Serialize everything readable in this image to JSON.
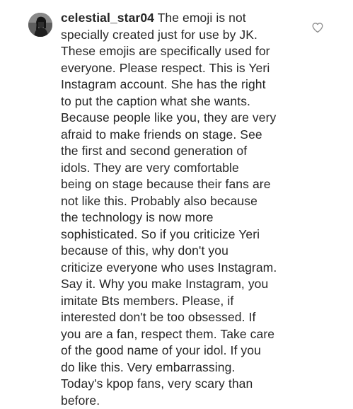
{
  "comment": {
    "username": "celestial_star04",
    "lines": [
      " The emoji is not",
      "specially created just for use by JK.",
      "These emojis are specifically used for",
      "everyone.  Please respect.  This is Yeri",
      "Instagram account.  She has the right",
      "to put the caption what she wants.",
      "Because people like you, they are very",
      "afraid to make friends on stage.  See",
      "the first and second generation of",
      "idols.  They are very comfortable",
      "being on stage because their fans are",
      "not like this.  Probably also because",
      "the technology is now more",
      "sophisticated.  So if you criticize Yeri",
      "because of this, why don't you",
      "criticize everyone who uses Instagram.",
      "Say it.  Why you make Instagram, you",
      "imitate Bts members.  Please, if",
      "interested don't be too obsessed.  If",
      "you are a fan, respect them.  Take care",
      "of the good name of your idol.  If you",
      "do like this.  Very embarrassing.",
      "Today's kpop fans, very scary than",
      "before."
    ]
  },
  "icons": {
    "avatar": "avatar",
    "like": "heart-outline-icon"
  },
  "colors": {
    "text": "#262626",
    "icon": "#8e8e8e",
    "background": "#ffffff"
  }
}
